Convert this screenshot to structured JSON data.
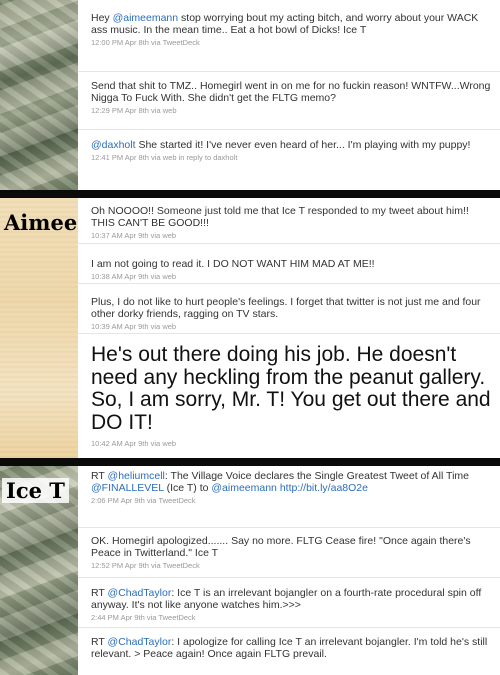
{
  "sections": {
    "icet_top": {
      "tweets": [
        {
          "parts": [
            "Hey ",
            "@aimeemann",
            " stop worrying bout my acting bitch, and worry about your WACK ass music. In the mean time.. Eat a hot bowl of Dicks! Ice T"
          ],
          "time": "12:00 PM Apr 8th",
          "via": "via",
          "source": "TweetDeck"
        },
        {
          "text": "Send that shit to TMZ.. Homegirl went in on me for no fuckin reason! WNTFW...Wrong Nigga To Fuck With. She didn't get the FLTG memo?",
          "time": "12:29 PM Apr 8th",
          "via": "via",
          "source": "web"
        },
        {
          "parts": [
            "@daxholt",
            " She started it! I've never even heard of her... I'm playing with my puppy!"
          ],
          "time": "12:41 PM Apr 8th",
          "via": "via",
          "source": "web",
          "reply_prefix": "in reply to",
          "reply_to": "daxholt"
        }
      ]
    },
    "aimee": {
      "label": "Aimee",
      "tweets": [
        {
          "text": "Oh NOOOO!! Someone just told me that Ice T responded to my tweet about him!! THIS CAN'T BE GOOD!!!",
          "time": "10:37 AM Apr 9th",
          "via": "via",
          "source": "web"
        },
        {
          "text": "I am not going to read it. I DO NOT WANT HIM MAD AT ME!!",
          "time": "10:38 AM Apr 9th",
          "via": "via",
          "source": "web"
        },
        {
          "text": "Plus, I do not like to hurt people's feelings. I forget that twitter is not just me and four other dorky friends, ragging on TV stars.",
          "time": "10:39 AM Apr 9th",
          "via": "via",
          "source": "web"
        },
        {
          "text": "He's out there doing his job. He doesn't need any heckling from the peanut gallery. So, I am sorry, Mr. T! You get out there and DO IT!",
          "time": "10:42 AM Apr 9th",
          "via": "via",
          "source": "web"
        }
      ]
    },
    "icet": {
      "label": "Ice T",
      "tweets": [
        {
          "parts": [
            "RT ",
            "@heliumcell",
            ": The Village Voice declares the Single Greatest Tweet of All Time ",
            "@FINALLEVEL",
            " (Ice T) to ",
            "@aimeemann",
            " ",
            "http://bit.ly/aa8O2e"
          ],
          "time": "2:06 PM Apr 9th",
          "via": "via",
          "source": "TweetDeck"
        },
        {
          "text": "OK. Homegirl apologized....... Say no more. FLTG Cease fire! \"Once again there's Peace in Twitterland.\" Ice T",
          "time": "12:52 PM Apr 9th",
          "via": "via",
          "source": "TweetDeck"
        },
        {
          "parts": [
            "RT ",
            "@ChadTaylor",
            ": Ice T is an irrelevant bojangler on a fourth-rate procedural spin off anyway. It's not like anyone watches him.>>>"
          ],
          "time": "2:44 PM Apr 9th",
          "via": "via",
          "source": "TweetDeck"
        },
        {
          "parts": [
            "RT ",
            "@ChadTaylor",
            ": I apologize for calling Ice T an irrelevant bojangler. I'm told he's still relevant. > Peace again! Once again FLTG prevail."
          ]
        }
      ]
    }
  },
  "colors": {
    "link": "#2a6ebb",
    "meta": "#999999",
    "divider": "#0a0a0a"
  }
}
